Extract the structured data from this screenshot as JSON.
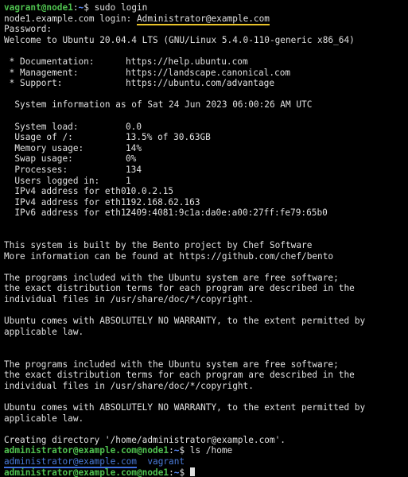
{
  "colors": {
    "background": "#000000",
    "text": "#e0e0e0",
    "prompt_user": "#4fc14f",
    "prompt_path": "#5b8cff",
    "directory": "#4a7bd9",
    "highlight_yellow": "#e8c229",
    "highlight_blue": "#3d6fe0"
  },
  "session": {
    "prompt1": {
      "user": "vagrant@node1",
      "path": "~",
      "symbol": "$",
      "command": " sudo login"
    },
    "login_prompt": "node1.example.com login: ",
    "login_user": "Administrator@example.com",
    "password_prompt": "Password:",
    "welcome": "Welcome to Ubuntu 20.04.4 LTS (GNU/Linux 5.4.0-110-generic x86_64)",
    "links": [
      {
        "label": " * Documentation:",
        "url": "https://help.ubuntu.com"
      },
      {
        "label": " * Management:",
        "url": "https://landscape.canonical.com"
      },
      {
        "label": " * Support:",
        "url": "https://ubuntu.com/advantage"
      }
    ],
    "sysinfo_header": "  System information as of Sat 24 Jun 2023 06:00:26 AM UTC",
    "sysinfo": [
      {
        "label": "  System load:",
        "value": "0.0"
      },
      {
        "label": "  Usage of /:",
        "value": "13.5% of 30.63GB"
      },
      {
        "label": "  Memory usage:",
        "value": "14%"
      },
      {
        "label": "  Swap usage:",
        "value": "0%"
      },
      {
        "label": "  Processes:",
        "value": "134"
      },
      {
        "label": "  Users logged in:",
        "value": "1"
      },
      {
        "label": "  IPv4 address for eth0:",
        "value": "10.0.2.15"
      },
      {
        "label": "  IPv4 address for eth1:",
        "value": "192.168.62.163"
      },
      {
        "label": "  IPv6 address for eth1:",
        "value": "2409:4081:9c1a:da0e:a00:27ff:fe79:65b0"
      }
    ],
    "bento": [
      "This system is built by the Bento project by Chef Software",
      "More information can be found at https://github.com/chef/bento"
    ],
    "free_software": [
      "The programs included with the Ubuntu system are free software;",
      "the exact distribution terms for each program are described in the",
      "individual files in /usr/share/doc/*/copyright."
    ],
    "warranty": [
      "Ubuntu comes with ABSOLUTELY NO WARRANTY, to the extent permitted by",
      "applicable law."
    ],
    "free_software_2": [
      "The programs included with the Ubuntu system are free software;",
      "the exact distribution terms for each program are described in the",
      "individual files in /usr/share/doc/*/copyright."
    ],
    "warranty_2": [
      "Ubuntu comes with ABSOLUTELY NO WARRANTY, to the extent permitted by",
      "applicable law."
    ],
    "creating_dir": "Creating directory '/home/administrator@example.com'.",
    "prompt2": {
      "user": "administrator@example.com@node1",
      "path": "~",
      "symbol": "$",
      "command": " ls /home"
    },
    "ls_output": {
      "dir1": "administrator@example.com",
      "dir2": "vagrant"
    },
    "prompt3": {
      "user": "administrator@example.com@node1",
      "path": "~",
      "symbol": "$"
    }
  }
}
